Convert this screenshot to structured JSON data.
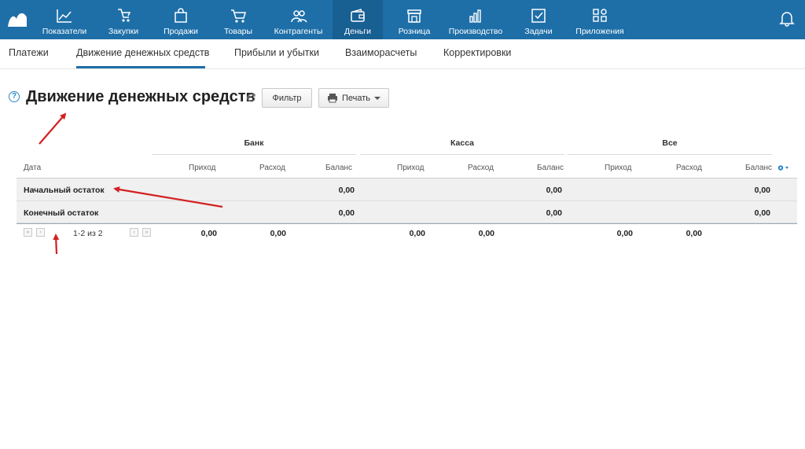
{
  "nav": {
    "items": [
      {
        "label": "Показатели",
        "icon": "chart-line-icon"
      },
      {
        "label": "Закупки",
        "icon": "cart-hand-icon"
      },
      {
        "label": "Продажи",
        "icon": "shopping-bag-icon"
      },
      {
        "label": "Товары",
        "icon": "cart-icon"
      },
      {
        "label": "Контрагенты",
        "icon": "people-icon"
      },
      {
        "label": "Деньги",
        "icon": "wallet-icon"
      },
      {
        "label": "Розница",
        "icon": "store-icon"
      },
      {
        "label": "Производство",
        "icon": "factory-icon"
      },
      {
        "label": "Задачи",
        "icon": "checkbox-icon"
      },
      {
        "label": "Приложения",
        "icon": "apps-icon"
      }
    ],
    "active": "Деньги",
    "bell_icon": "bell-icon",
    "color": "#1e6fa8"
  },
  "subnav": {
    "tabs": [
      "Платежи",
      "Движение денежных средств",
      "Прибыли и убытки",
      "Взаиморасчеты",
      "Корректировки"
    ],
    "active": "Движение денежных средств"
  },
  "page": {
    "help": "?",
    "title": "Движение денежных средств",
    "filter_label": "Фильтр",
    "print_label": "Печать"
  },
  "table": {
    "groups": [
      "Банк",
      "Касса",
      "Все"
    ],
    "date_col": "Дата",
    "sub_cols": [
      "Приход",
      "Расход",
      "Баланс"
    ],
    "rows": [
      {
        "label": "Начальный остаток",
        "balances": [
          "0,00",
          "0,00",
          "0,00"
        ]
      },
      {
        "label": "Конечный остаток",
        "balances": [
          "0,00",
          "0,00",
          "0,00"
        ]
      }
    ],
    "pager": "1-2 из 2",
    "totals": [
      "0,00",
      "0,00",
      "0,00",
      "0,00",
      "0,00",
      "0,00"
    ]
  }
}
